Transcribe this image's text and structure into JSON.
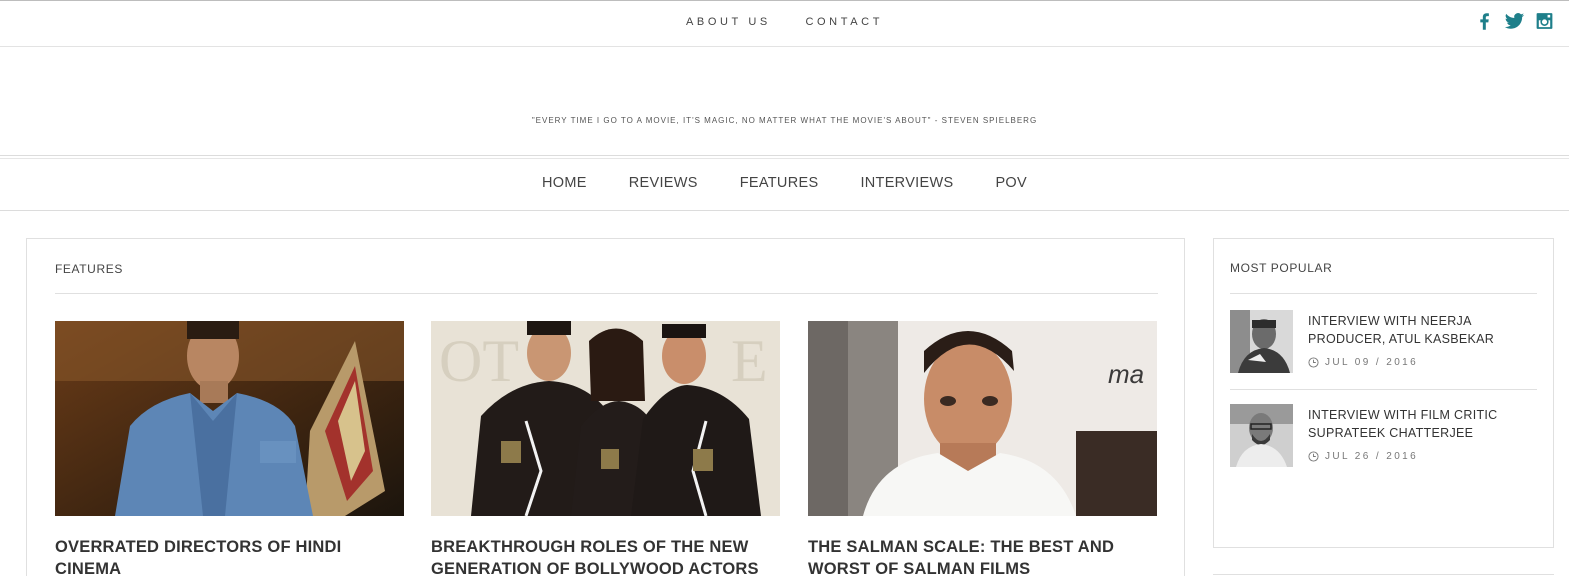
{
  "top_nav": {
    "items": [
      "ABOUT US",
      "CONTACT"
    ]
  },
  "social": {
    "icons": [
      "facebook-icon",
      "twitter-icon",
      "instagram-icon"
    ],
    "color": "#1e7f8a"
  },
  "tagline": "\"EVERY TIME I GO TO A MOVIE, IT'S MAGIC, NO MATTER WHAT THE MOVIE'S ABOUT\" - STEVEN SPIELBERG",
  "main_nav": {
    "items": [
      "HOME",
      "REVIEWS",
      "FEATURES",
      "INTERVIEWS",
      "POV"
    ]
  },
  "features": {
    "heading": "FEATURES",
    "cards": [
      {
        "title": "OVERRATED DIRECTORS OF HINDI CINEMA"
      },
      {
        "title": "BREAKTHROUGH ROLES OF THE NEW GENERATION OF BOLLYWOOD ACTORS"
      },
      {
        "title": "THE SALMAN SCALE: THE BEST AND WORST OF SALMAN FILMS"
      }
    ]
  },
  "most_popular": {
    "heading": "MOST POPULAR",
    "items": [
      {
        "title": "INTERVIEW WITH NEERJA PRODUCER, ATUL KASBEKAR",
        "date": "JUL 09 / 2016"
      },
      {
        "title": "INTERVIEW WITH FILM CRITIC SUPRATEEK CHATTERJEE",
        "date": "JUL 26 / 2016"
      }
    ]
  }
}
